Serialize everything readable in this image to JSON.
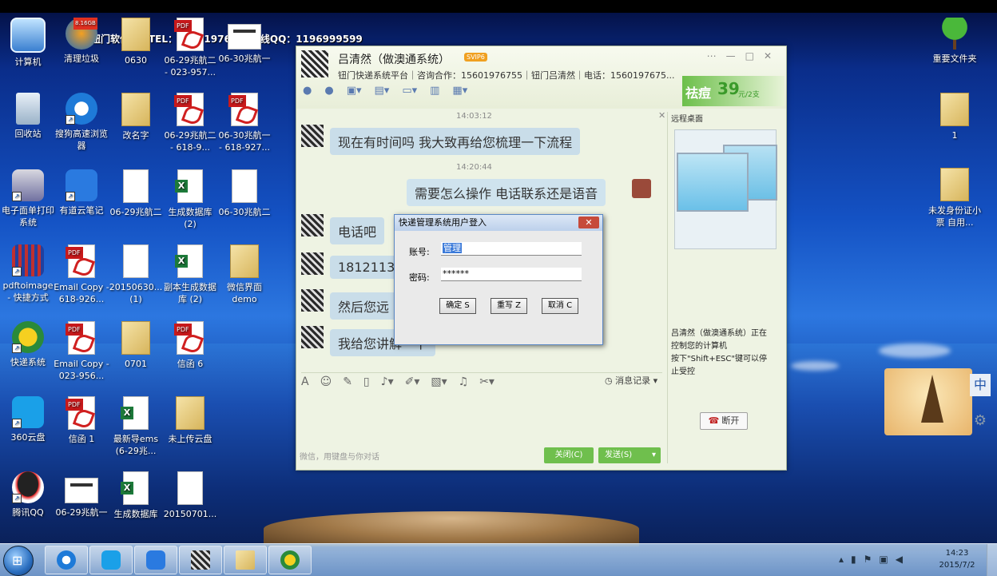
{
  "banner": "钮门软件购买TEL：15601976755在线QQ：1196999599",
  "desktop_icons": [
    {
      "label": "计算机"
    },
    {
      "label": "清理垃圾",
      "badge": "8.16GB"
    },
    {
      "label": "0630"
    },
    {
      "label": "06-29兆航二 - 023-957..."
    },
    {
      "label": "06-30兆航一"
    },
    {
      "label": "回收站"
    },
    {
      "label": "搜狗高速浏览器"
    },
    {
      "label": "改名字"
    },
    {
      "label": "06-29兆航二 - 618-9..."
    },
    {
      "label": "06-30兆航一 - 618-927..."
    },
    {
      "label": "电子面单打印系统"
    },
    {
      "label": "有道云笔记"
    },
    {
      "label": "06-29兆航二"
    },
    {
      "label": "生成数据库 (2)"
    },
    {
      "label": "06-30兆航二"
    },
    {
      "label": "pdftoimage - 快捷方式"
    },
    {
      "label": "Email Copy - 618-926..."
    },
    {
      "label": "20150630... (1)"
    },
    {
      "label": "副本生成数据库 (2)"
    },
    {
      "label": "微信界面demo"
    },
    {
      "label": "快递系统"
    },
    {
      "label": "Email Copy - 023-956..."
    },
    {
      "label": "0701"
    },
    {
      "label": "信函 6"
    },
    {
      "label": "360云盘"
    },
    {
      "label": "信函 1"
    },
    {
      "label": "最新导ems (6-29兆..."
    },
    {
      "label": "未上传云盘"
    },
    {
      "label": "腾讯QQ"
    },
    {
      "label": "06-29兆航一"
    },
    {
      "label": "生成数据库"
    },
    {
      "label": "20150701..."
    },
    {
      "label": "重要文件夹"
    },
    {
      "label": "1"
    },
    {
      "label": "未发身份证小票 自用..."
    }
  ],
  "chat": {
    "title": "吕清然（做澳通系统）",
    "vip": "SVIP6",
    "subtitle": "钮门快递系统平台｜咨询合作：15601976755｜钮门吕清然｜电话：1560197675...",
    "ad": {
      "brand": "祛痘",
      "price": "39",
      "unit": "元/2支"
    },
    "messages": [
      {
        "time": "14:03:12",
        "text": "现在有时间吗   我大致再给您梳理一下流程",
        "side": "left"
      },
      {
        "time": "14:20:44",
        "text": "需要怎么操作  电话联系还是语音",
        "side": "right"
      },
      {
        "text": "电话吧",
        "side": "left"
      },
      {
        "text": "1812113",
        "side": "left"
      },
      {
        "text": "然后您远",
        "side": "left"
      },
      {
        "text": "我给您讲解一下",
        "side": "left"
      }
    ],
    "remote_title": "远程桌面",
    "remote_note": "吕清然（做澳通系统）正在控制您的计算机\n按下\"Shift+ESC\"键可以停止受控",
    "hangup": "断开",
    "history": "消息记录",
    "input_hint": "微信，用键盘与你对话",
    "close_btn": "关闭(C)",
    "send_btn": "发送(S)"
  },
  "dialog": {
    "title": "快递管理系统用户登入",
    "account_label": "账号:",
    "account_value": "管理",
    "password_label": "密码:",
    "password_value": "******",
    "ok": "确定 S",
    "rewrite": "重写 Z",
    "cancel": "取消 C"
  },
  "ime": "中",
  "clock": {
    "time": "14:23",
    "date": "2015/7/2"
  }
}
